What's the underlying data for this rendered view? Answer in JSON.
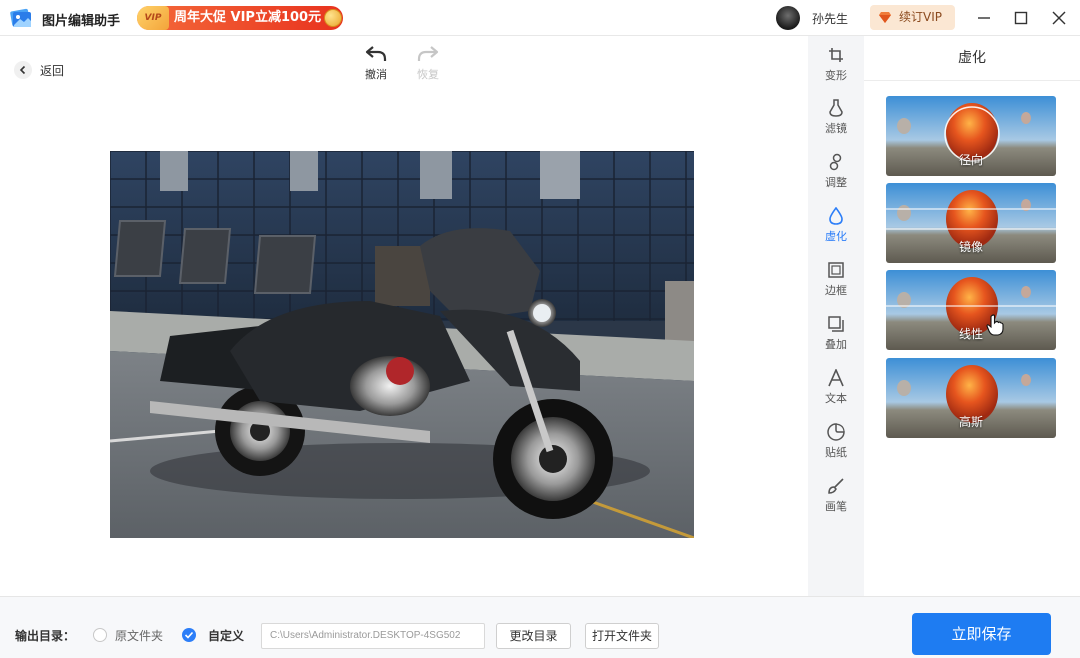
{
  "app": {
    "title": "图片编辑助手",
    "promo_tag": "VIP",
    "promo_text": "周年大促 VIP立减100元"
  },
  "user": {
    "name": "孙先生",
    "vip_button": "续订VIP"
  },
  "toolbar": {
    "back_label": "返回",
    "undo_label": "撤消",
    "redo_label": "恢复"
  },
  "tools": [
    {
      "id": "transform",
      "label": "变形",
      "icon": "crop-icon"
    },
    {
      "id": "filter",
      "label": "滤镜",
      "icon": "flask-icon"
    },
    {
      "id": "adjust",
      "label": "调整",
      "icon": "adjust-icon"
    },
    {
      "id": "blur",
      "label": "虚化",
      "icon": "droplet-icon",
      "active": true
    },
    {
      "id": "border",
      "label": "边框",
      "icon": "frame-icon"
    },
    {
      "id": "overlay",
      "label": "叠加",
      "icon": "layers-icon"
    },
    {
      "id": "text",
      "label": "文本",
      "icon": "text-icon"
    },
    {
      "id": "sticker",
      "label": "贴纸",
      "icon": "sticker-icon"
    },
    {
      "id": "brush",
      "label": "画笔",
      "icon": "brush-icon"
    }
  ],
  "panel": {
    "title": "虚化",
    "effects": [
      {
        "label": "径向"
      },
      {
        "label": "镜像"
      },
      {
        "label": "线性"
      },
      {
        "label": "高斯"
      }
    ]
  },
  "footer": {
    "output_label": "输出目录：",
    "option_original": "原文件夹",
    "option_custom": "自定义",
    "path_value": "C:\\Users\\Administrator.DESKTOP-4SG502",
    "change_dir": "更改目录",
    "open_folder": "打开文件夹",
    "save": "立即保存"
  },
  "colors": {
    "accent": "#1e7cf2",
    "promo": "#e8321e",
    "vip_bg": "#fbe7d3"
  }
}
